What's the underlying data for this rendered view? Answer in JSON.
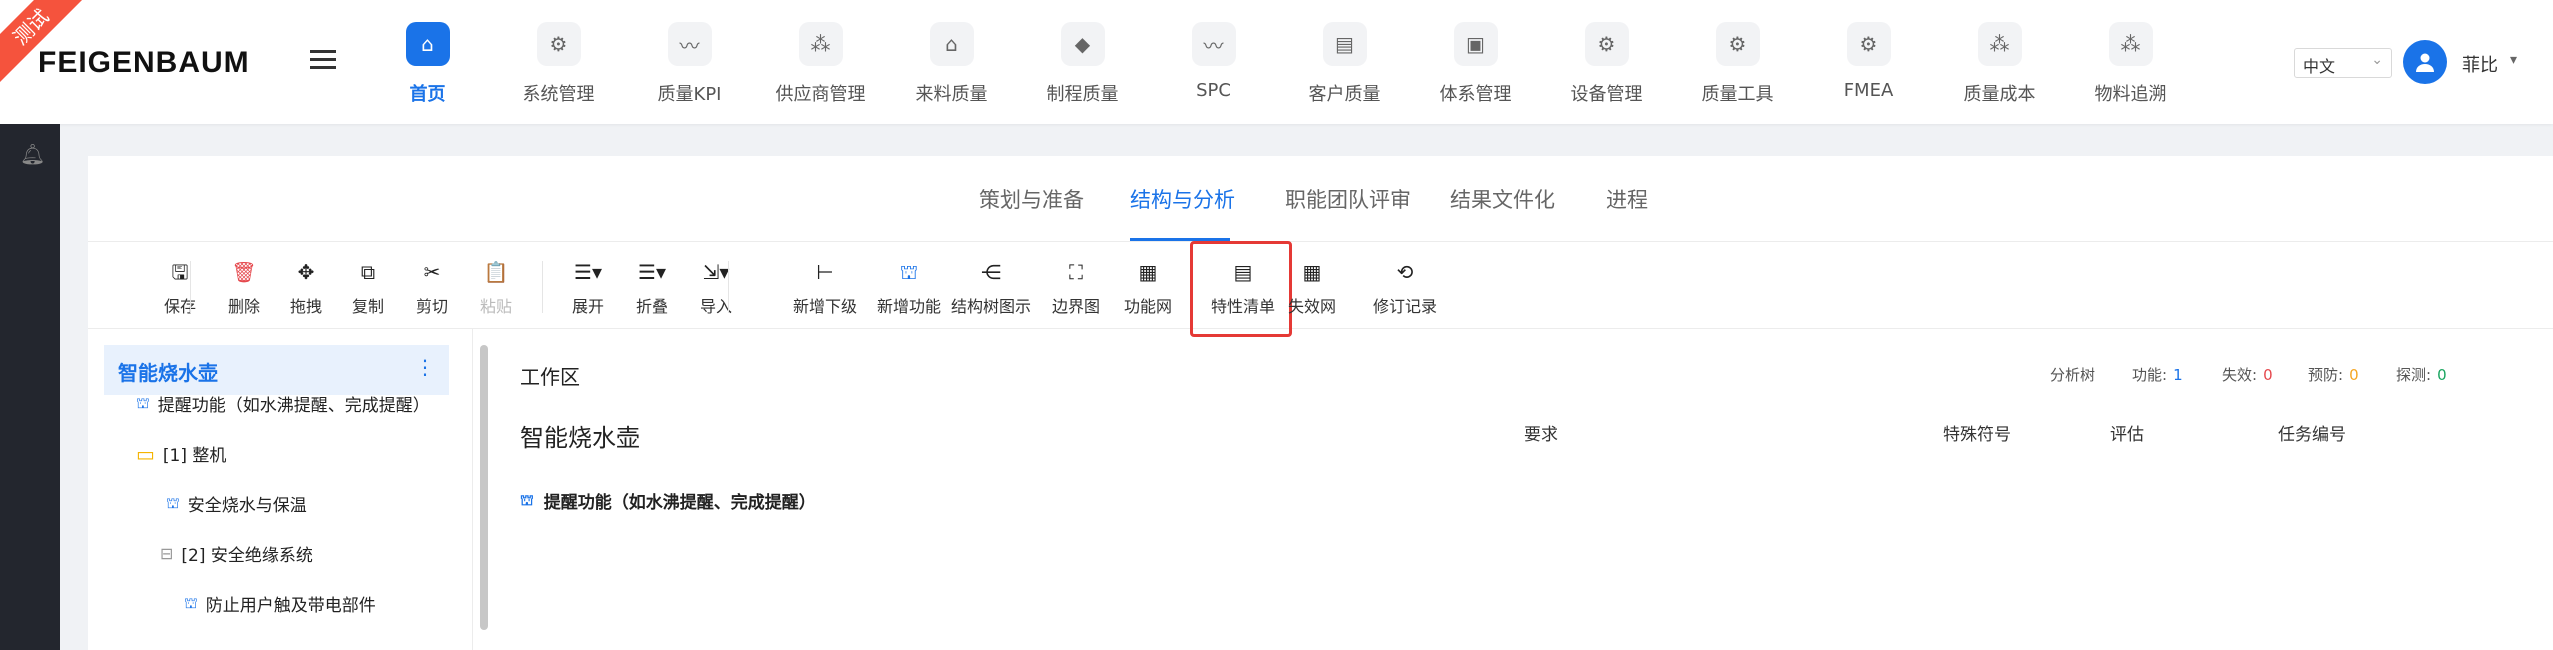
{
  "badge": "测试",
  "logo": "FEIGENBAUM",
  "nav": [
    {
      "label": "首页",
      "icon": "home-icon",
      "glyph": "⌂",
      "active": true
    },
    {
      "label": "系统管理",
      "icon": "gear-icon",
      "glyph": "⚙"
    },
    {
      "label": "质量KPI",
      "icon": "pulse-icon",
      "glyph": "〰"
    },
    {
      "label": "供应商管理",
      "icon": "nodes-icon",
      "glyph": "⁂"
    },
    {
      "label": "来料质量",
      "icon": "inbox-icon",
      "glyph": "⌂"
    },
    {
      "label": "制程质量",
      "icon": "cube-icon",
      "glyph": "◆"
    },
    {
      "label": "SPC",
      "icon": "pulse-icon",
      "glyph": "〰"
    },
    {
      "label": "客户质量",
      "icon": "report-icon",
      "glyph": "▤"
    },
    {
      "label": "体系管理",
      "icon": "folder-user-icon",
      "glyph": "▣"
    },
    {
      "label": "设备管理",
      "icon": "gear-icon",
      "glyph": "⚙"
    },
    {
      "label": "质量工具",
      "icon": "gear-icon",
      "glyph": "⚙"
    },
    {
      "label": "FMEA",
      "icon": "gear-icon",
      "glyph": "⚙"
    },
    {
      "label": "质量成本",
      "icon": "nodes-icon",
      "glyph": "⁂"
    },
    {
      "label": "物料追溯",
      "icon": "nodes-icon",
      "glyph": "⁂"
    }
  ],
  "language": "中文",
  "user": {
    "name": "菲比"
  },
  "tabs": [
    {
      "label": "策划与准备"
    },
    {
      "label": "结构与分析",
      "active": true
    },
    {
      "label": "职能团队评审"
    },
    {
      "label": "结果文件化"
    },
    {
      "label": "进程"
    }
  ],
  "toolbar": [
    {
      "label": "保存",
      "icon": "save-icon",
      "glyph": "🖫"
    },
    {
      "label": "删除",
      "icon": "trash-icon",
      "glyph": "🗑",
      "style": "red"
    },
    {
      "label": "拖拽",
      "icon": "move-icon",
      "glyph": "✥"
    },
    {
      "label": "复制",
      "icon": "copy-icon",
      "glyph": "⧉"
    },
    {
      "label": "剪切",
      "icon": "scissors-icon",
      "glyph": "✂"
    },
    {
      "label": "粘贴",
      "icon": "paste-icon",
      "glyph": "📋",
      "style": "disabled"
    },
    {
      "label": "展开",
      "icon": "expand-icon",
      "glyph": "☰▾"
    },
    {
      "label": "折叠",
      "icon": "collapse-icon",
      "glyph": "☰▾"
    },
    {
      "label": "导入",
      "icon": "import-icon",
      "glyph": "⇲▾"
    },
    {
      "label": "新增下级",
      "icon": "add-child-icon",
      "glyph": "⊢"
    },
    {
      "label": "新增功能",
      "icon": "function-icon",
      "glyph": "⛫",
      "style": "blue"
    },
    {
      "label": "结构树图示",
      "icon": "share-icon",
      "glyph": "⋲"
    },
    {
      "label": "边界图",
      "icon": "boundary-icon",
      "glyph": "⛶"
    },
    {
      "label": "功能网",
      "icon": "grid-icon",
      "glyph": "▦"
    },
    {
      "label": "特性清单",
      "icon": "list-icon",
      "glyph": "▤",
      "highlighted": true
    },
    {
      "label": "失效网",
      "icon": "table-icon",
      "glyph": "▦"
    },
    {
      "label": "修订记录",
      "icon": "history-icon",
      "glyph": "⟲"
    }
  ],
  "tree": {
    "root": "智能烧水壶",
    "rows": [
      {
        "label": "提醒功能（如水沸提醒、完成提醒）",
        "type": "function"
      },
      {
        "label": "[1] 整机",
        "type": "folder"
      },
      {
        "label": "安全烧水与保温",
        "type": "function"
      },
      {
        "label": "[2] 安全绝缘系统",
        "type": "collapse"
      },
      {
        "label": "防止用户触及带电部件",
        "type": "function"
      }
    ]
  },
  "workarea": {
    "title": "工作区",
    "analysis_tree_label": "分析树",
    "stats": [
      {
        "label": "功能:",
        "value": "1",
        "color": "#1a73e8"
      },
      {
        "label": "失效:",
        "value": "0",
        "color": "#e5484d"
      },
      {
        "label": "预防:",
        "value": "0",
        "color": "#f5a623"
      },
      {
        "label": "探测:",
        "value": "0",
        "color": "#1aa560"
      }
    ],
    "heading": "智能烧水壶",
    "columns": [
      "要求",
      "特殊符号",
      "评估",
      "任务编号"
    ],
    "function_row": "提醒功能（如水沸提醒、完成提醒）"
  }
}
